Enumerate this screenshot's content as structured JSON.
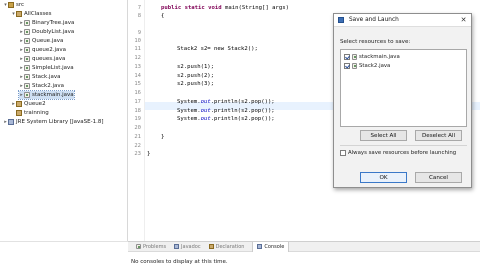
{
  "explorer": {
    "items": [
      {
        "label": "src",
        "level": 0,
        "type": "src",
        "twisty": "▾"
      },
      {
        "label": "AllClasses",
        "level": 1,
        "type": "pkg",
        "twisty": "▾"
      },
      {
        "label": "BinaryTree.java",
        "level": 2,
        "type": "java",
        "twisty": "▸"
      },
      {
        "label": "DoublyList.java",
        "level": 2,
        "type": "java",
        "twisty": "▸"
      },
      {
        "label": "Queue.java",
        "level": 2,
        "type": "java",
        "twisty": "▸"
      },
      {
        "label": "queue2.java",
        "level": 2,
        "type": "java",
        "twisty": "▸"
      },
      {
        "label": "queues.java",
        "level": 2,
        "type": "java",
        "twisty": "▸"
      },
      {
        "label": "SimpleList.java",
        "level": 2,
        "type": "java",
        "twisty": "▸"
      },
      {
        "label": "Stack.java",
        "level": 2,
        "type": "java",
        "twisty": "▸"
      },
      {
        "label": "Stack2.java",
        "level": 2,
        "type": "java",
        "twisty": "▸"
      },
      {
        "label": "stackmain.java",
        "level": 2,
        "type": "java",
        "twisty": "▸",
        "selected": true
      },
      {
        "label": "Queue2",
        "level": 1,
        "type": "pkg",
        "twisty": "▸"
      },
      {
        "label": "trainning",
        "level": 1,
        "type": "pkg",
        "twisty": ""
      },
      {
        "label": "JRE System Library [JavaSE-1.8]",
        "level": 0,
        "type": "lib",
        "twisty": "▸"
      }
    ]
  },
  "editor": {
    "line_numbers": [
      "7",
      "8",
      "9",
      "10",
      "11",
      "12",
      "13",
      "14",
      "15",
      "16",
      "17",
      "18",
      "19",
      "20",
      "21",
      "22",
      "23"
    ],
    "lines": {
      "l7_kw": "public static void ",
      "l7_rest": "main(String[] args)",
      "l8": "{",
      "l11": "Stack2 s2= new Stack2();",
      "l13": "s2.push(1);",
      "l14": "s2.push(2);",
      "l15": "s2.push(3);",
      "l17a": "System.",
      "l17b": "out",
      "l17c": ".println(s2.pop());",
      "l18a": "System.",
      "l18b": "out",
      "l18c": ".println(s2.pop());",
      "l19a": "System.",
      "l19b": "out",
      "l19c": ".println(s2.pop());",
      "l20": "}",
      "l22": "}"
    }
  },
  "console": {
    "tabs": [
      "Problems",
      "Javadoc",
      "Declaration",
      "Console"
    ],
    "message": "No consoles to display at this time."
  },
  "dialog": {
    "title": "Save and Launch",
    "close": "✕",
    "prompt": "Select resources to save:",
    "resources": [
      {
        "label": "stackmain.java",
        "checked": true
      },
      {
        "label": "Stack2.java",
        "checked": true
      }
    ],
    "select_all": "Select All",
    "deselect_all": "Deselect All",
    "always_label": "Always save resources before launching",
    "ok": "OK",
    "cancel": "Cancel"
  }
}
